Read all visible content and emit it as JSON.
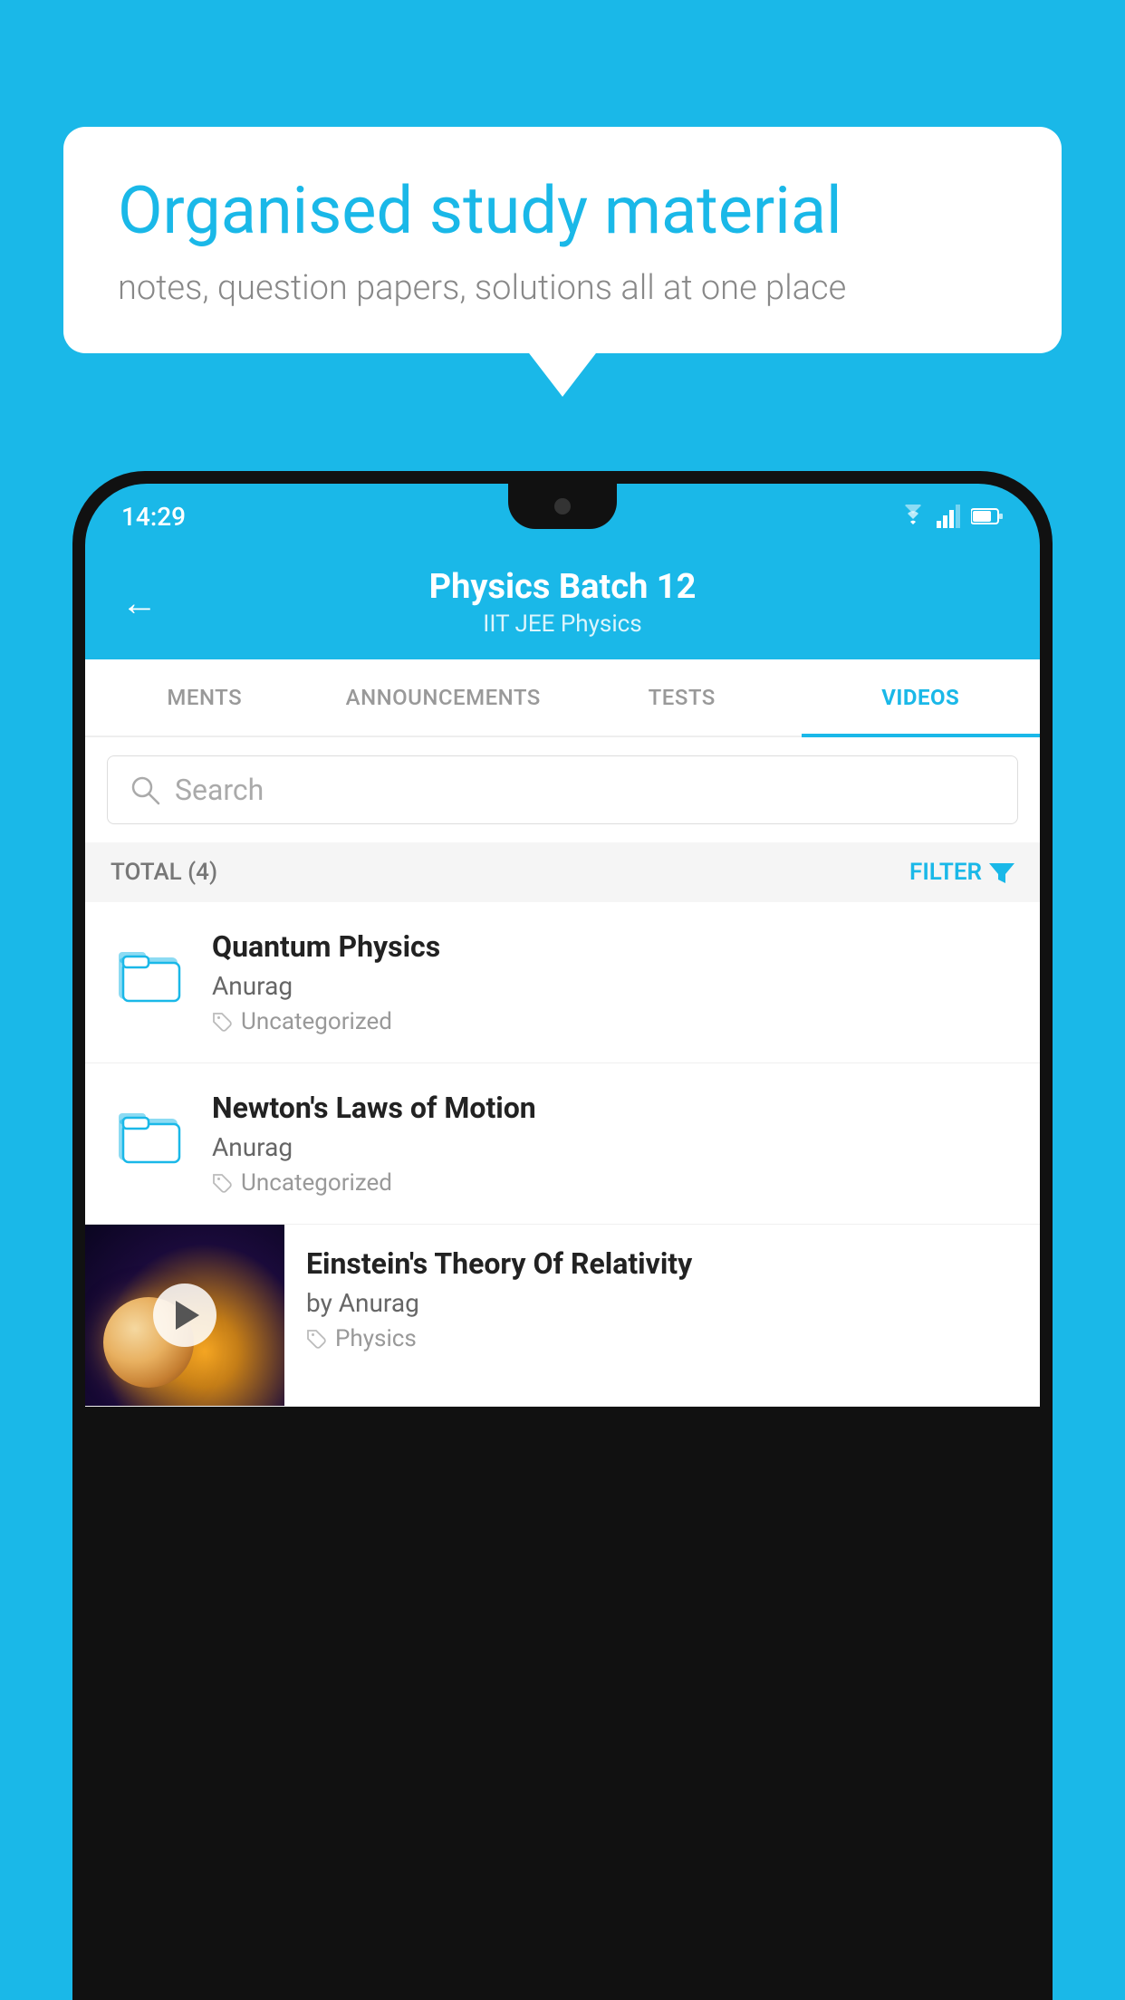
{
  "page": {
    "background_color": "#1ab8e8"
  },
  "speech_bubble": {
    "title": "Organised study material",
    "subtitle": "notes, question papers, solutions all at one place"
  },
  "status_bar": {
    "time": "14:29"
  },
  "header": {
    "title": "Physics Batch 12",
    "subtitle": "IIT JEE   Physics",
    "back_label": "←"
  },
  "tabs": [
    {
      "label": "MENTS",
      "active": false
    },
    {
      "label": "ANNOUNCEMENTS",
      "active": false
    },
    {
      "label": "TESTS",
      "active": false
    },
    {
      "label": "VIDEOS",
      "active": true
    }
  ],
  "search": {
    "placeholder": "Search"
  },
  "filter_bar": {
    "total_label": "TOTAL (4)",
    "filter_label": "FILTER"
  },
  "video_items": [
    {
      "id": 1,
      "title": "Quantum Physics",
      "author": "Anurag",
      "tag": "Uncategorized",
      "has_thumbnail": false
    },
    {
      "id": 2,
      "title": "Newton's Laws of Motion",
      "author": "Anurag",
      "tag": "Uncategorized",
      "has_thumbnail": false
    },
    {
      "id": 3,
      "title": "Einstein's Theory Of Relativity",
      "author": "by Anurag",
      "tag": "Physics",
      "has_thumbnail": true
    }
  ]
}
